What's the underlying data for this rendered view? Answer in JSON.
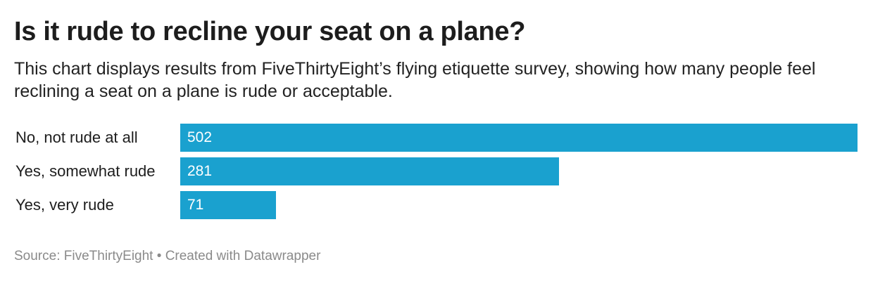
{
  "title": "Is it rude to recline your seat on a plane?",
  "subtitle": "This chart displays results from FiveThirtyEight’s flying etiquette survey, showing how many people feel reclining a seat on a plane is rude or acceptable.",
  "footer": {
    "source": "Source: FiveThirtyEight",
    "separator": "•",
    "credit": "Created with Datawrapper"
  },
  "colors": {
    "bar": "#1aa1cf"
  },
  "chart_data": {
    "type": "bar",
    "orientation": "horizontal",
    "title": "Is it rude to recline your seat on a plane?",
    "categories": [
      "No, not rude at all",
      "Yes, somewhat rude",
      "Yes, very rude"
    ],
    "values": [
      502,
      281,
      71
    ],
    "xlim": [
      0,
      502
    ],
    "grid": false,
    "legend": "none",
    "data_labels": true
  }
}
